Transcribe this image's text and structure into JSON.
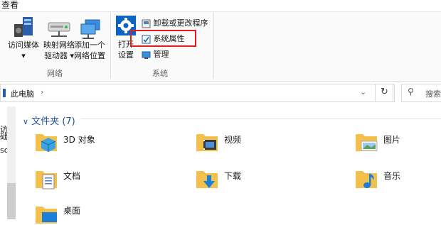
{
  "ribbon": {
    "tab_label": "查看",
    "network_group": {
      "label": "网络",
      "access_media": [
        "访问媒体",
        "▾"
      ],
      "map_drive": [
        "映射网络",
        "驱动器 ▾"
      ],
      "add_location": [
        "添加一个",
        "网络位置"
      ]
    },
    "system_group": {
      "label": "系统",
      "open_settings": [
        "打开",
        "设置"
      ],
      "uninstall": "卸载或更改程序",
      "system_properties": "系统属性",
      "manage": "管理"
    }
  },
  "address": {
    "breadcrumb": "此电脑",
    "search_placeholder": "搜索"
  },
  "nav_pane": {
    "fragments": [
      "访",
      "础",
      "sc"
    ]
  },
  "content": {
    "section_header": "文件夹 (7)",
    "folders": [
      {
        "name": "3D 对象",
        "icon": "3d-objects-icon"
      },
      {
        "name": "视频",
        "icon": "video-icon"
      },
      {
        "name": "图片",
        "icon": "pictures-icon"
      },
      {
        "name": "文档",
        "icon": "documents-icon"
      },
      {
        "name": "下载",
        "icon": "downloads-icon"
      },
      {
        "name": "音乐",
        "icon": "music-icon"
      },
      {
        "name": "桌面",
        "icon": "desktop-icon"
      }
    ]
  },
  "colors": {
    "accent": "#0078d7",
    "folder": "#f3c14b",
    "highlight_border": "#e21b1b"
  }
}
